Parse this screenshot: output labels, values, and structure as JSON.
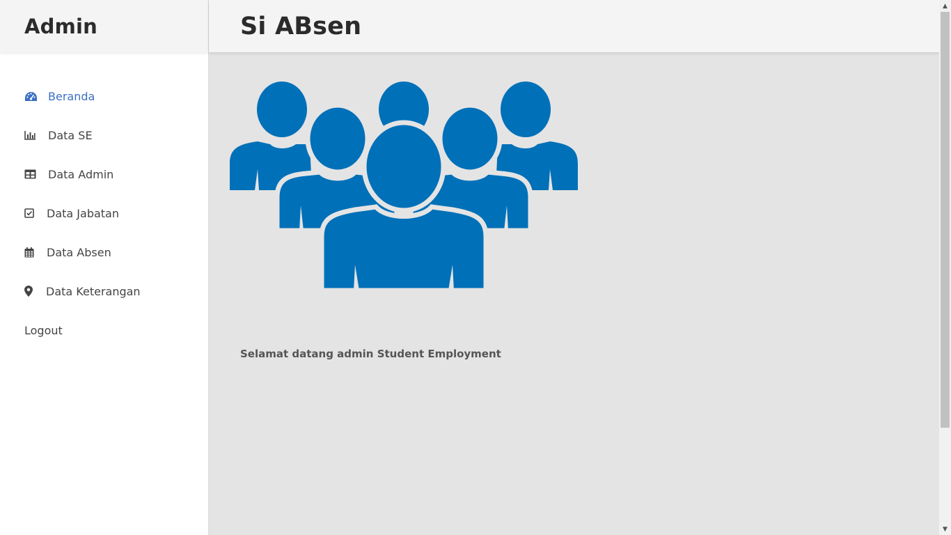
{
  "sidebar": {
    "title": "Admin",
    "items": [
      {
        "label": "Beranda",
        "icon": "dashboard-icon",
        "active": true
      },
      {
        "label": "Data SE",
        "icon": "bar-chart-icon"
      },
      {
        "label": "Data Admin",
        "icon": "table-icon"
      },
      {
        "label": "Data Jabatan",
        "icon": "checkbox-icon"
      },
      {
        "label": "Data Absen",
        "icon": "calendar-icon"
      },
      {
        "label": "Data Keterangan",
        "icon": "map-marker-icon"
      },
      {
        "label": "Logout"
      }
    ]
  },
  "header": {
    "title": "Si ABsen"
  },
  "main": {
    "illustration": "people-group-icon",
    "welcome": "Selamat datang admin Student Employment"
  },
  "colors": {
    "accent": "#3a6fc4",
    "illustration": "#0070b8",
    "content_bg": "#e4e4e4",
    "header_bg": "#f4f4f4"
  }
}
